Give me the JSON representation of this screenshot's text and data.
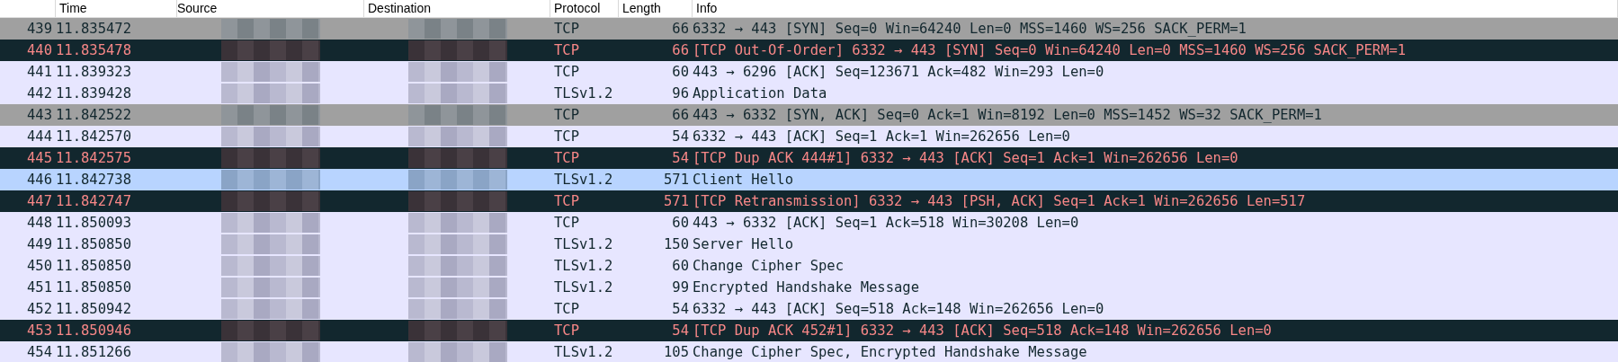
{
  "columns": [
    "Time",
    "Source",
    "Destination",
    "Protocol",
    "Length",
    "Info"
  ],
  "rows": [
    {
      "no": "439",
      "time": "11.835472",
      "protocol": "TCP",
      "length": "66",
      "info": "6332 → 443 [SYN] Seq=0 Win=64240 Len=0 MSS=1460 WS=256 SACK_PERM=1",
      "kind": "syn",
      "selected": false
    },
    {
      "no": "440",
      "time": "11.835478",
      "protocol": "TCP",
      "length": "66",
      "info": "[TCP Out-Of-Order] 6332 → 443 [SYN] Seq=0 Win=64240 Len=0 MSS=1460 WS=256 SACK_PERM=1",
      "kind": "bad",
      "selected": false
    },
    {
      "no": "441",
      "time": "11.839323",
      "protocol": "TCP",
      "length": "60",
      "info": "443 → 6296 [ACK] Seq=123671 Ack=482 Win=293 Len=0",
      "kind": "normal",
      "selected": false
    },
    {
      "no": "442",
      "time": "11.839428",
      "protocol": "TLSv1.2",
      "length": "96",
      "info": "Application Data",
      "kind": "normal",
      "selected": false
    },
    {
      "no": "443",
      "time": "11.842522",
      "protocol": "TCP",
      "length": "66",
      "info": "443 → 6332 [SYN, ACK] Seq=0 Ack=1 Win=8192 Len=0 MSS=1452 WS=32 SACK_PERM=1",
      "kind": "syn",
      "selected": false
    },
    {
      "no": "444",
      "time": "11.842570",
      "protocol": "TCP",
      "length": "54",
      "info": "6332 → 443 [ACK] Seq=1 Ack=1 Win=262656 Len=0",
      "kind": "normal",
      "selected": false
    },
    {
      "no": "445",
      "time": "11.842575",
      "protocol": "TCP",
      "length": "54",
      "info": "[TCP Dup ACK 444#1] 6332 → 443 [ACK] Seq=1 Ack=1 Win=262656 Len=0",
      "kind": "bad",
      "selected": false
    },
    {
      "no": "446",
      "time": "11.842738",
      "protocol": "TLSv1.2",
      "length": "571",
      "info": "Client Hello",
      "kind": "normal",
      "selected": true
    },
    {
      "no": "447",
      "time": "11.842747",
      "protocol": "TCP",
      "length": "571",
      "info": "[TCP Retransmission] 6332 → 443 [PSH, ACK] Seq=1 Ack=1 Win=262656 Len=517",
      "kind": "bad",
      "selected": false
    },
    {
      "no": "448",
      "time": "11.850093",
      "protocol": "TCP",
      "length": "60",
      "info": "443 → 6332 [ACK] Seq=1 Ack=518 Win=30208 Len=0",
      "kind": "normal",
      "selected": false
    },
    {
      "no": "449",
      "time": "11.850850",
      "protocol": "TLSv1.2",
      "length": "150",
      "info": "Server Hello",
      "kind": "normal",
      "selected": false
    },
    {
      "no": "450",
      "time": "11.850850",
      "protocol": "TLSv1.2",
      "length": "60",
      "info": "Change Cipher Spec",
      "kind": "normal",
      "selected": false
    },
    {
      "no": "451",
      "time": "11.850850",
      "protocol": "TLSv1.2",
      "length": "99",
      "info": "Encrypted Handshake Message",
      "kind": "normal",
      "selected": false
    },
    {
      "no": "452",
      "time": "11.850942",
      "protocol": "TCP",
      "length": "54",
      "info": "6332 → 443 [ACK] Seq=518 Ack=148 Win=262656 Len=0",
      "kind": "normal",
      "selected": false
    },
    {
      "no": "453",
      "time": "11.850946",
      "protocol": "TCP",
      "length": "54",
      "info": "[TCP Dup ACK 452#1] 6332 → 443 [ACK] Seq=518 Ack=148 Win=262656 Len=0",
      "kind": "bad",
      "selected": false
    },
    {
      "no": "454",
      "time": "11.851266",
      "protocol": "TLSv1.2",
      "length": "105",
      "info": "Change Cipher Spec, Encrypted Handshake Message",
      "kind": "normal",
      "selected": false
    }
  ]
}
